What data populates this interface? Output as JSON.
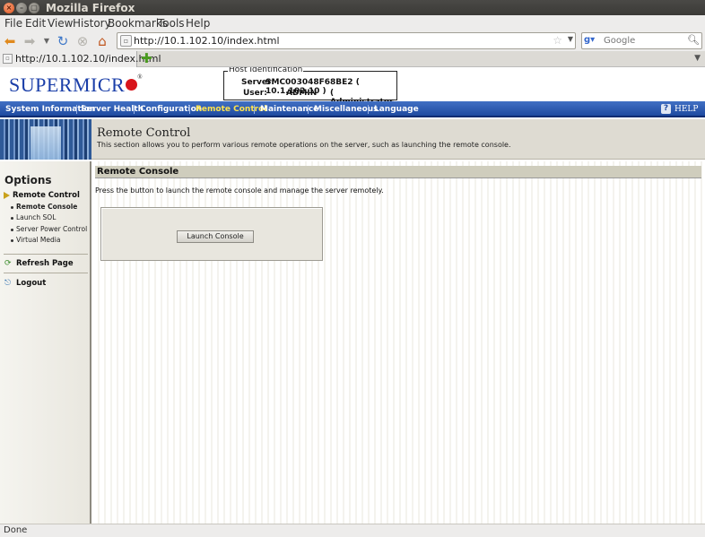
{
  "window": {
    "title": "Mozilla Firefox"
  },
  "menubar": [
    "File",
    "Edit",
    "View",
    "History",
    "Bookmarks",
    "Tools",
    "Help"
  ],
  "toolbar": {
    "url": "http://10.1.102.10/index.html",
    "search_placeholder": "Google",
    "tab_label": "http://10.1.102.10/index.html"
  },
  "brand": {
    "logo_text": "SUPERMICR",
    "registered": "®"
  },
  "host": {
    "legend": "Host Identification",
    "server_label": "Server:",
    "server_value": "SMC003048F68BE2 (   10.1.102.10   )",
    "user_label": "User:",
    "user_value": "ADMIN",
    "user_role": "( Administrator )"
  },
  "nav": {
    "items": [
      "System Information",
      "Server Health",
      "Configuration",
      "Remote Control",
      "Maintenance",
      "Miscellaneous",
      "Language"
    ],
    "active": "Remote Control",
    "help": "HELP"
  },
  "banner": {
    "title": "Remote Control",
    "description": "This section allows you to perform various remote operations on the server, such as launching the remote console."
  },
  "sidebar": {
    "title": "Options",
    "section": "Remote Control",
    "links": [
      "Remote Console",
      "Launch SOL",
      "Server Power Control",
      "Virtual Media"
    ],
    "current": "Remote Console",
    "refresh": "Refresh Page",
    "logout": "Logout"
  },
  "content": {
    "heading": "Remote Console",
    "text": "Press the button to launch the remote console and manage the server remotely.",
    "button": "Launch Console"
  },
  "status": {
    "text": "Done"
  },
  "colors": {
    "nav_bg": "#1f4aa0",
    "nav_active": "#ffe34d",
    "logo_blue": "#1a3ea8",
    "logo_red": "#d8151b"
  }
}
